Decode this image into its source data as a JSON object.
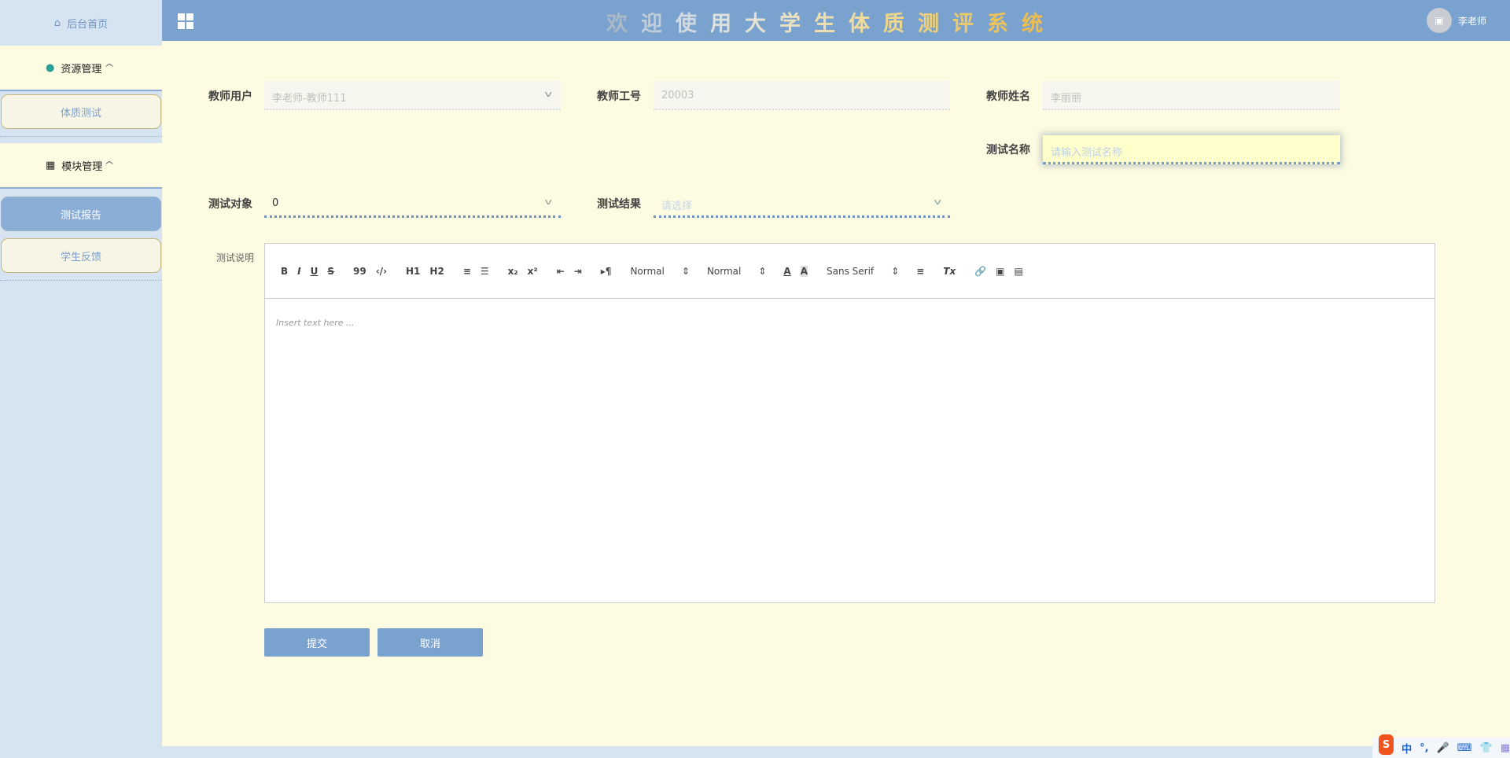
{
  "sidebar": {
    "home": "后台首页",
    "groups": [
      {
        "label": "资源管理",
        "items": [
          "体质测试"
        ]
      },
      {
        "label": "模块管理",
        "items": [
          "测试报告",
          "学生反馈"
        ]
      }
    ]
  },
  "header": {
    "title": [
      "欢",
      "迎",
      "使",
      "用",
      "大",
      "学",
      "生",
      "体",
      "质",
      "测",
      "评",
      "系",
      "统"
    ],
    "user": "李老师"
  },
  "form": {
    "teacher_user": {
      "label": "教师用户",
      "value": "李老师-教师111"
    },
    "teacher_id": {
      "label": "教师工号",
      "value": "20003"
    },
    "teacher_name": {
      "label": "教师姓名",
      "value": "李丽丽"
    },
    "test_name": {
      "label": "测试名称",
      "placeholder": "请输入测试名称"
    },
    "test_target": {
      "label": "测试对象",
      "value": "0"
    },
    "test_result": {
      "label": "测试结果",
      "placeholder": "请选择"
    },
    "description": {
      "label": "测试说明",
      "placeholder": "Insert text here ..."
    }
  },
  "toolbar": {
    "bold": "B",
    "italic": "I",
    "underline": "U",
    "strike": "S",
    "quote": "99",
    "code": "‹/›",
    "h1": "H1",
    "h2": "H2",
    "ol": "≡",
    "ul": "☰",
    "sub": "x₂",
    "sup": "x²",
    "outdent": "⇤",
    "indent": "⇥",
    "rtl": "▸¶",
    "size": "Normal",
    "header": "Normal",
    "color": "A",
    "bg": "A",
    "font": "Sans Serif",
    "align": "≡",
    "clean": "Tx",
    "link": "🔗",
    "image": "▣",
    "video": "▤"
  },
  "buttons": {
    "submit": "提交",
    "cancel": "取消"
  },
  "ime": {
    "logo": "S",
    "lang": "中",
    "punct": "°,"
  }
}
